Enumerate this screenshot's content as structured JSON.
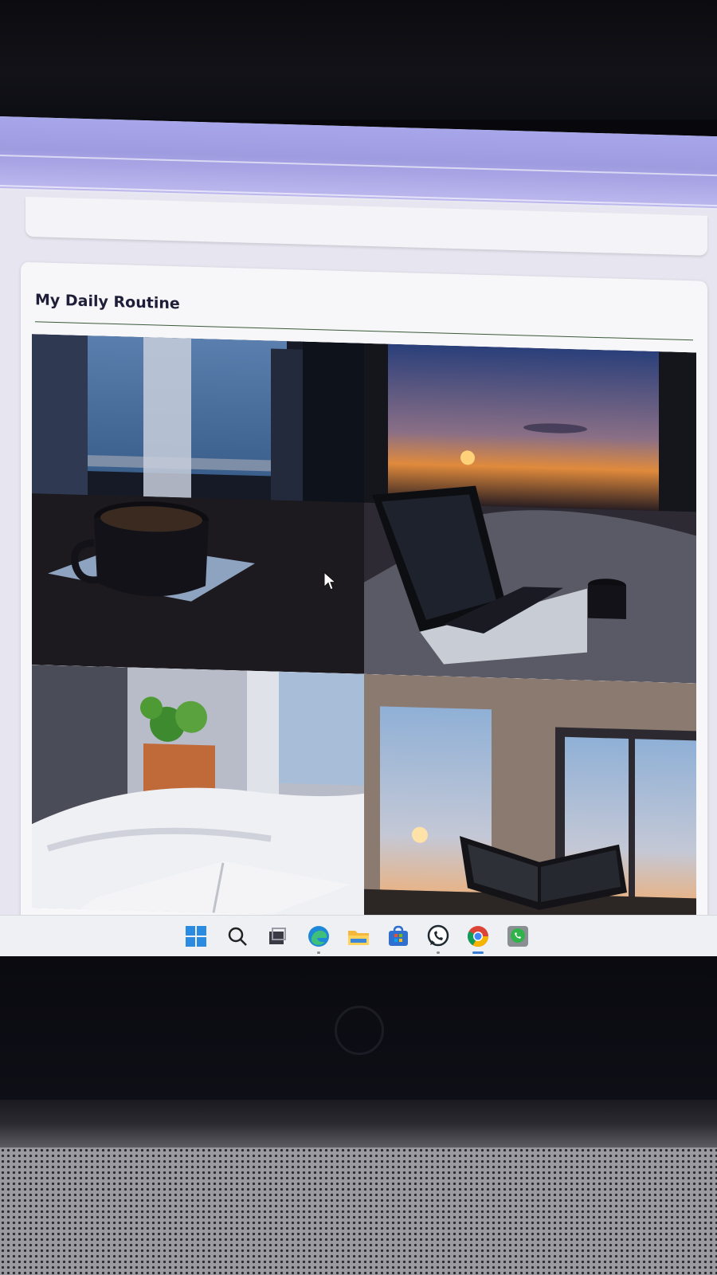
{
  "card": {
    "title": "My Daily Routine"
  },
  "photos": [
    {
      "name": "coffee-cup-window-photo"
    },
    {
      "name": "laptop-sunset-bed-photo"
    },
    {
      "name": "bed-plant-book-photo"
    },
    {
      "name": "reading-book-window-photo"
    }
  ],
  "taskbar": {
    "icons": [
      "windows-start-icon",
      "search-icon",
      "task-view-icon",
      "edge-icon",
      "file-explorer-icon",
      "microsoft-store-icon",
      "whatsapp-icon",
      "chrome-icon",
      "whatsapp-business-icon"
    ],
    "active_app": "chrome-icon"
  },
  "colors": {
    "browser_bar": "#a8a6ea",
    "page_background": "#e7e6f0",
    "card_title": "#1e1e38",
    "taskbar": "#eef0f4"
  }
}
